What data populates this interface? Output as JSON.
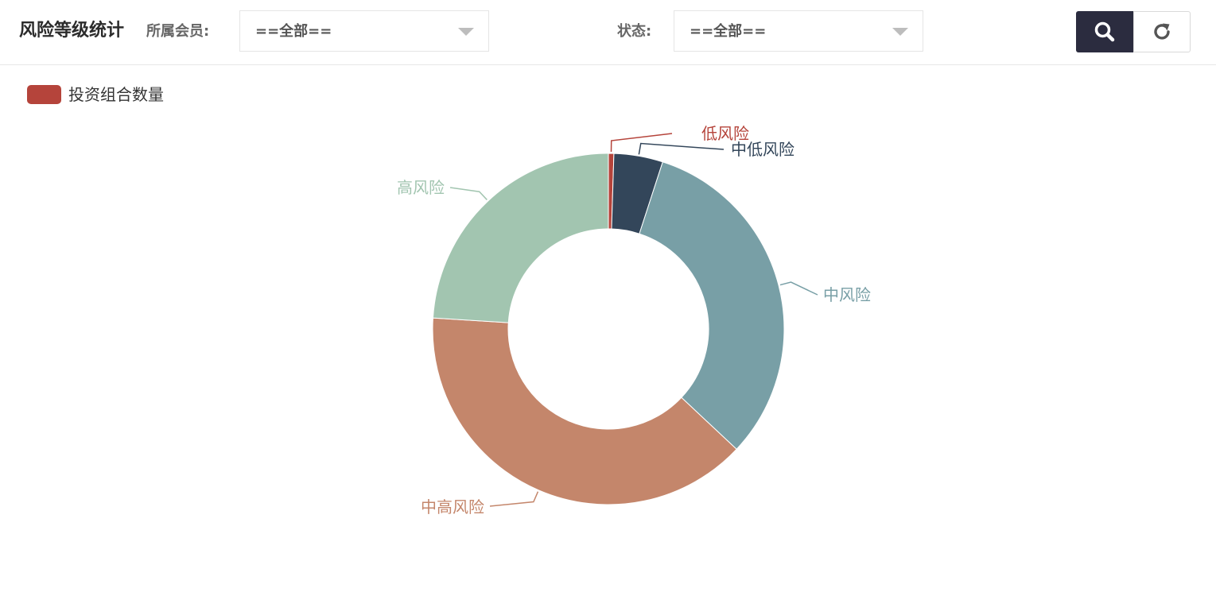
{
  "header": {
    "title": "风险等级统计",
    "member_label": "所属会员:",
    "member_value": "==全部==",
    "status_label": "状态:",
    "status_value": "==全部=="
  },
  "toolbar": {
    "search_icon": "search-icon",
    "refresh_icon": "refresh-icon"
  },
  "chart_data": {
    "type": "pie",
    "style": "donut",
    "legend": [
      "投资组合数量"
    ],
    "legend_position": "top-left",
    "categories": [
      "低风险",
      "中低风险",
      "中风险",
      "中高风险",
      "高风险"
    ],
    "values": [
      0.5,
      4.5,
      32,
      39,
      24
    ],
    "colors": [
      "#b5443b",
      "#33465a",
      "#789fa6",
      "#c4866b",
      "#a2c5b0"
    ]
  }
}
